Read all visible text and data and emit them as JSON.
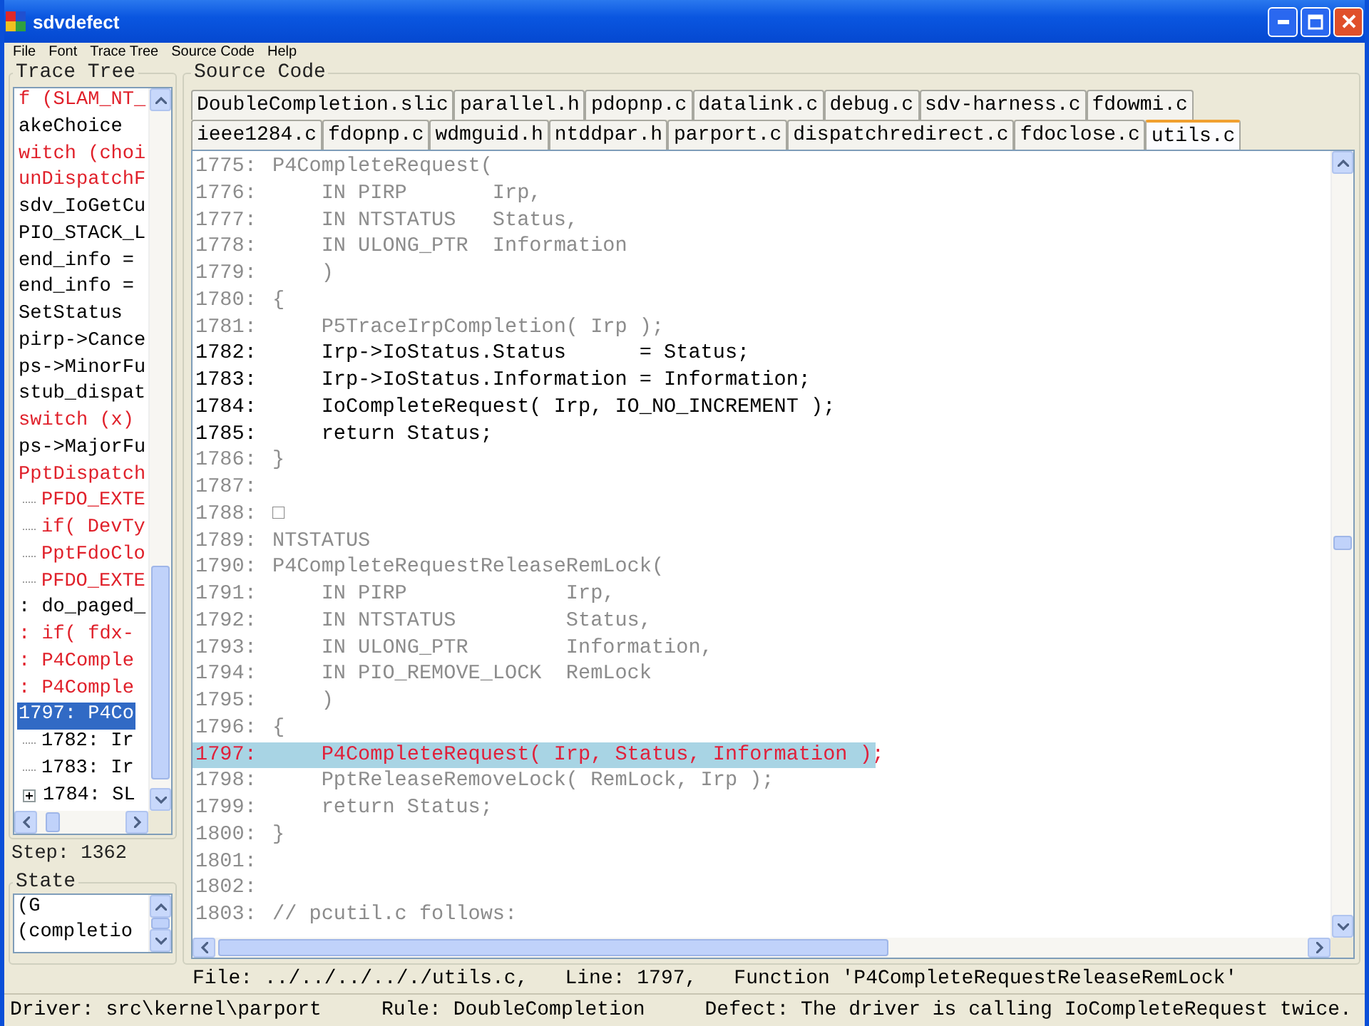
{
  "window": {
    "title": "sdvdefect"
  },
  "menu": [
    "File",
    "Font",
    "Trace Tree",
    "Source Code",
    "Help"
  ],
  "trace_tree": {
    "title": "Trace Tree",
    "items": [
      {
        "text": "f (SLAM_NT_",
        "color": "#e0202a",
        "selected": false
      },
      {
        "text": "akeChoice",
        "color": "#000000",
        "selected": false
      },
      {
        "text": "witch (choi",
        "color": "#e0202a",
        "selected": false
      },
      {
        "text": "unDispatchF",
        "color": "#e0202a",
        "selected": false
      },
      {
        "text": "sdv_IoGetCu",
        "color": "#000000",
        "selected": false
      },
      {
        "text": "PIO_STACK_L",
        "color": "#000000",
        "selected": false
      },
      {
        "text": "end_info =",
        "color": "#000000",
        "selected": false
      },
      {
        "text": "end_info =",
        "color": "#000000",
        "selected": false
      },
      {
        "text": "SetStatus",
        "color": "#000000",
        "selected": false
      },
      {
        "text": "pirp->Cance",
        "color": "#000000",
        "selected": false
      },
      {
        "text": "ps->MinorFu",
        "color": "#000000",
        "selected": false
      },
      {
        "text": "stub_dispat",
        "color": "#000000",
        "selected": false
      },
      {
        "text": "switch (x)",
        "color": "#e0202a",
        "selected": false
      },
      {
        "text": "ps->MajorFu",
        "color": "#000000",
        "selected": false
      },
      {
        "text": "PptDispatch",
        "color": "#e0202a",
        "selected": false,
        "children": [
          {
            "text": "PFDO_EXTE",
            "color": "#e0202a",
            "selected": false
          },
          {
            "text": "if( DevTy",
            "color": "#e0202a",
            "selected": false
          },
          {
            "text": "PptFdoClo",
            "color": "#e0202a",
            "selected": false
          },
          {
            "text": "PFDO_EXTE",
            "color": "#e0202a",
            "selected": false
          }
        ]
      },
      {
        "text": ": do_paged_",
        "color": "#000000",
        "selected": false
      },
      {
        "text": ": if( fdx-",
        "color": "#e0202a",
        "selected": false
      },
      {
        "text": ": P4Comple",
        "color": "#e0202a",
        "selected": false
      },
      {
        "text": ": P4Comple",
        "color": "#e0202a",
        "selected": false
      },
      {
        "text": "1797: P4Co",
        "selected": true,
        "children": [
          {
            "text": "1782: Ir",
            "color": "#000000",
            "selected": false
          },
          {
            "text": "1783: Ir",
            "color": "#000000",
            "selected": false
          },
          {
            "text": "1784: SL",
            "color": "#000000",
            "selected": false,
            "expanded": false
          }
        ]
      }
    ]
  },
  "step": "Step: 1362",
  "state": {
    "title": "State",
    "lines": [
      "(G",
      "(completio"
    ]
  },
  "source": {
    "title": "Source Code",
    "tab_rows": [
      {
        "tabs": [
          {
            "label": "DoubleCompletion.slic",
            "selected": false
          },
          {
            "label": "parallel.h",
            "selected": false
          },
          {
            "label": "pdopnp.c",
            "selected": false
          },
          {
            "label": "datalink.c",
            "selected": false
          },
          {
            "label": "debug.c",
            "selected": false
          },
          {
            "label": "sdv-harness.c",
            "selected": false
          },
          {
            "label": "fdowmi.c",
            "selected": false
          }
        ]
      },
      {
        "tabs": [
          {
            "label": "ieee1284.c",
            "selected": false
          },
          {
            "label": "fdopnp.c",
            "selected": false
          },
          {
            "label": "wdmguid.h",
            "selected": false
          },
          {
            "label": "ntddpar.h",
            "selected": false
          },
          {
            "label": "parport.c",
            "selected": false
          },
          {
            "label": "dispatchredirect.c",
            "selected": false
          },
          {
            "label": "fdoclose.c",
            "selected": false
          },
          {
            "label": "utils.c",
            "selected": true
          }
        ]
      }
    ],
    "lines": [
      {
        "number": "1775:",
        "text": "P4CompleteRequest(",
        "kind": "inactive",
        "selected": false
      },
      {
        "number": "1776:",
        "text": "    IN PIRP       Irp,",
        "kind": "inactive",
        "selected": false
      },
      {
        "number": "1777:",
        "text": "    IN NTSTATUS   Status,",
        "kind": "inactive",
        "selected": false
      },
      {
        "number": "1778:",
        "text": "    IN ULONG_PTR  Information",
        "kind": "inactive",
        "selected": false
      },
      {
        "number": "1779:",
        "text": "    )",
        "kind": "inactive",
        "selected": false
      },
      {
        "number": "1780:",
        "text": "{",
        "kind": "inactive",
        "selected": false
      },
      {
        "number": "1781:",
        "text": "    P5TraceIrpCompletion( Irp );",
        "kind": "inactive",
        "selected": false
      },
      {
        "number": "1782:",
        "text": "    Irp->IoStatus.Status      = Status;",
        "kind": "executed",
        "selected": false
      },
      {
        "number": "1783:",
        "text": "    Irp->IoStatus.Information = Information;",
        "kind": "executed",
        "selected": false
      },
      {
        "number": "1784:",
        "text": "    IoCompleteRequest( Irp, IO_NO_INCREMENT );",
        "kind": "executed",
        "selected": false
      },
      {
        "number": "1785:",
        "text": "    return Status;",
        "kind": "executed",
        "selected": false
      },
      {
        "number": "1786:",
        "text": "}",
        "kind": "inactive",
        "selected": false
      },
      {
        "number": "1787:",
        "kind": "inactive",
        "selected": false
      },
      {
        "number": "1788:",
        "text": "□",
        "kind": "inactive",
        "selected": false
      },
      {
        "number": "1789:",
        "text": "NTSTATUS",
        "kind": "inactive",
        "selected": false
      },
      {
        "number": "1790:",
        "text": "P4CompleteRequestReleaseRemLock(",
        "kind": "inactive",
        "selected": false
      },
      {
        "number": "1791:",
        "text": "    IN PIRP             Irp,",
        "kind": "inactive",
        "selected": false
      },
      {
        "number": "1792:",
        "text": "    IN NTSTATUS         Status,",
        "kind": "inactive",
        "selected": false
      },
      {
        "number": "1793:",
        "text": "    IN ULONG_PTR        Information,",
        "kind": "inactive",
        "selected": false
      },
      {
        "number": "1794:",
        "text": "    IN PIO_REMOVE_LOCK  RemLock",
        "kind": "inactive",
        "selected": false
      },
      {
        "number": "1795:",
        "text": "    )",
        "kind": "inactive",
        "selected": false
      },
      {
        "number": "1796:",
        "text": "{",
        "kind": "inactive",
        "selected": false
      },
      {
        "number": "1797:",
        "text": "    P4CompleteRequest( Irp, Status, Information );",
        "kind": "executed",
        "selected": true
      },
      {
        "number": "1798:",
        "text": "    PptReleaseRemoveLock( RemLock, Irp );",
        "kind": "inactive",
        "selected": false
      },
      {
        "number": "1799:",
        "text": "    return Status;",
        "kind": "inactive",
        "selected": false
      },
      {
        "number": "1800:",
        "text": "}",
        "kind": "inactive",
        "selected": false
      },
      {
        "number": "1801:",
        "kind": "inactive",
        "selected": false
      },
      {
        "number": "1802:",
        "kind": "inactive",
        "selected": false
      },
      {
        "number": "1803:",
        "text": "// pcutil.c follows:",
        "kind": "inactive",
        "selected": false
      }
    ]
  },
  "location": [
    "File: ../../../.././utils.c,",
    "Line: 1797,",
    "Function 'P4CompleteRequestReleaseRemLock'"
  ],
  "status_bar": [
    "Driver: src\\kernel\\parport",
    "Rule: DoubleCompletion",
    "Defect: The driver is calling IoCompleteRequest twice."
  ]
}
